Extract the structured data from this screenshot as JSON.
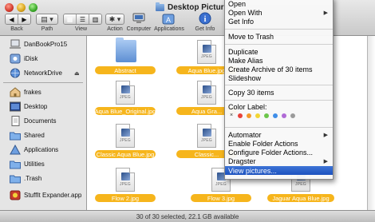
{
  "window": {
    "title": "Desktop Pictures",
    "toolbar": {
      "back_label": "Back",
      "path_label": "Path",
      "view_label": "View",
      "action_label": "Action",
      "computer_label": "Computer",
      "applications_label": "Applications",
      "getinfo_label": "Get Info"
    },
    "status": "30 of 30 selected, 22.1 GB available"
  },
  "sidebar": {
    "items": [
      {
        "label": "DanBookPro15",
        "icon": "laptop-icon"
      },
      {
        "label": "iDisk",
        "icon": "idisk-icon"
      },
      {
        "label": "NetworkDrive",
        "icon": "globe-icon",
        "eject": "⏏"
      },
      {
        "label": "frakes",
        "icon": "home-icon"
      },
      {
        "label": "Desktop",
        "icon": "desktop-icon"
      },
      {
        "label": "Documents",
        "icon": "documents-icon"
      },
      {
        "label": "Shared",
        "icon": "shared-folder-icon"
      },
      {
        "label": "Applications",
        "icon": "applications-icon"
      },
      {
        "label": "Utilities",
        "icon": "utilities-folder-icon"
      },
      {
        "label": ".Trash",
        "icon": "trash-folder-icon"
      },
      {
        "label": "StuffIt Expander.app",
        "icon": "stuffit-icon"
      }
    ]
  },
  "files": [
    {
      "name": "Abstract",
      "kind": "folder"
    },
    {
      "name": "Aqua Blue.jpg",
      "kind": "jpeg"
    },
    {
      "name": "Aqua Blue_Original.jpg",
      "kind": "jpeg"
    },
    {
      "name": "Aqua Gra...",
      "kind": "jpeg"
    },
    {
      "name": "Classic Aqua Blue.jpg",
      "kind": "jpeg"
    },
    {
      "name": "Classic...",
      "kind": "jpeg"
    },
    {
      "name": "Flow 2.jpg",
      "kind": "jpeg"
    },
    {
      "name": "Flow 3.jpg",
      "kind": "jpeg"
    },
    {
      "name": "Jaguar Aqua Blue.jpg",
      "kind": "jpeg"
    }
  ],
  "jpeg_tag": "JPEG",
  "context_menu": {
    "items": {
      "open": "Open",
      "open_with": "Open With",
      "get_info": "Get Info",
      "move_to_trash": "Move to Trash",
      "duplicate": "Duplicate",
      "make_alias": "Make Alias",
      "create_archive": "Create Archive of 30 items",
      "slideshow": "Slideshow",
      "copy": "Copy 30 items",
      "color_label": "Color Label:",
      "automator": "Automator",
      "enable_folder_actions": "Enable Folder Actions",
      "configure_folder_actions": "Configure Folder Actions...",
      "dragster": "Dragster",
      "view_pictures": "View pictures..."
    },
    "submenu_arrow": "▶",
    "label_colors": [
      "#e8423a",
      "#f39a2b",
      "#f2d634",
      "#6cc64a",
      "#3f8ee8",
      "#b06ad6",
      "#9b9b9b"
    ],
    "label_none": "×",
    "highlight_color": "#1d52bf"
  },
  "colors": {
    "selection_pill": "#f6b51c",
    "sidebar_bg": "#e5e5e5"
  }
}
